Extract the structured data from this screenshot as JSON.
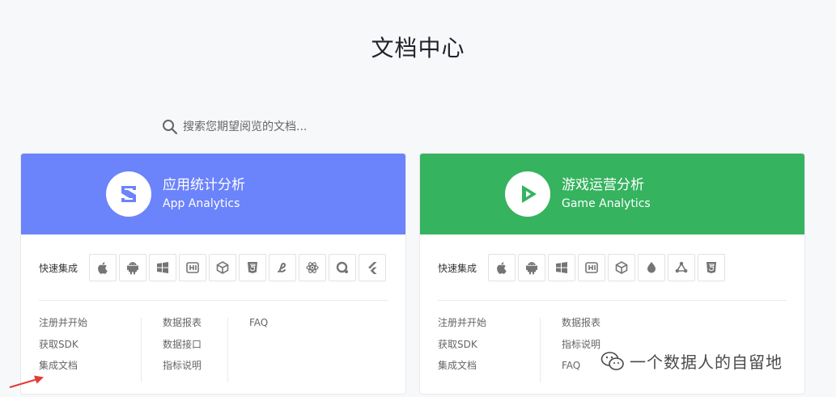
{
  "page": {
    "title": "文档中心"
  },
  "search": {
    "placeholder": "搜索您期望阅览的文档..."
  },
  "cards": [
    {
      "title_cn": "应用统计分析",
      "title_en": "App Analytics",
      "header_color": "#6b83fb",
      "quick_label": "快速集成",
      "sdk_icons": [
        "apple-icon",
        "android-icon",
        "windows-icon",
        "hbuilder-icon",
        "unity-icon",
        "html5-icon",
        "weex-icon",
        "react-native-icon",
        "quickapp-icon",
        "flutter-icon"
      ],
      "links": [
        [
          "注册并开始",
          "获取SDK",
          "集成文档"
        ],
        [
          "数据报表",
          "数据接口",
          "指标说明"
        ],
        [
          "FAQ"
        ]
      ]
    },
    {
      "title_cn": "游戏运营分析",
      "title_en": "Game Analytics",
      "header_color": "#35b35f",
      "quick_label": "快速集成",
      "sdk_icons": [
        "apple-icon",
        "android-icon",
        "windows-icon",
        "hbuilder-icon",
        "unity-icon",
        "cocos-icon",
        "egret-icon",
        "html5-icon"
      ],
      "links": [
        [
          "注册并开始",
          "获取SDK",
          "集成文档"
        ],
        [
          "数据报表",
          "指标说明",
          "FAQ"
        ]
      ]
    }
  ],
  "watermark": {
    "text": "一个数据人的自留地"
  },
  "colors": {
    "arrow": "#e53935",
    "text_link": "#666666"
  }
}
